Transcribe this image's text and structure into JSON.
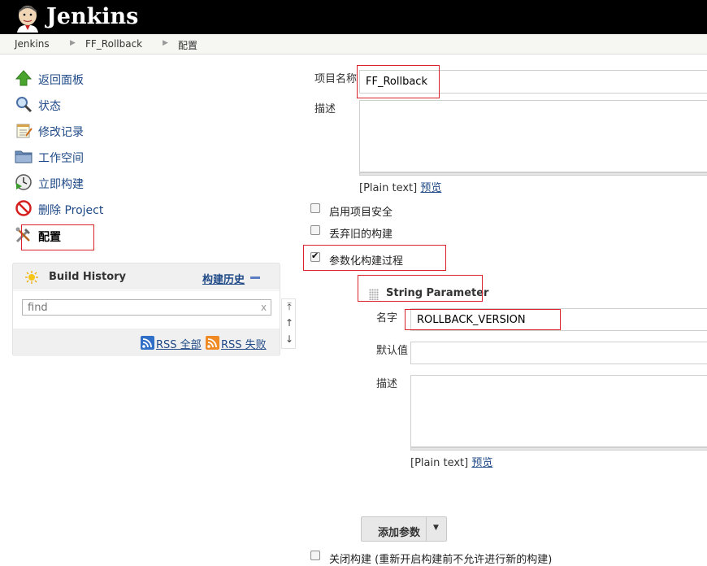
{
  "header": {
    "brand": "Jenkins"
  },
  "breadcrumb": [
    "Jenkins",
    "FF_Rollback",
    "配置"
  ],
  "side_tasks": [
    {
      "label": "返回面板",
      "icon": "up-arrow-icon"
    },
    {
      "label": "状态",
      "icon": "magnifier-icon"
    },
    {
      "label": "修改记录",
      "icon": "notepad-icon"
    },
    {
      "label": "工作空间",
      "icon": "folder-icon"
    },
    {
      "label": "立即构建",
      "icon": "clock-play-icon"
    },
    {
      "label": "删除 Project",
      "icon": "no-entry-icon"
    },
    {
      "label": "配置",
      "icon": "tools-icon"
    }
  ],
  "build_history": {
    "title": "Build History",
    "trend_link": "构建历史",
    "search_placeholder": "find",
    "clear": "x",
    "rss_all": "RSS 全部",
    "rss_failures": "RSS 失败"
  },
  "form": {
    "project_name_label": "项目名称",
    "project_name_value": "FF_Rollback",
    "description_label": "描述",
    "plain_text": "[Plain text]",
    "preview": "预览",
    "options": [
      {
        "label": "启用项目安全",
        "checked": false
      },
      {
        "label": "丢弃旧的构建",
        "checked": false
      },
      {
        "label": "参数化构建过程",
        "checked": true
      }
    ],
    "string_param": {
      "title": "String Parameter",
      "name_label": "名字",
      "name_value": "ROLLBACK_VERSION",
      "default_label": "默认值",
      "default_value": "",
      "desc_label": "描述"
    },
    "add_param_button": "添加参数",
    "disable_build_label": "关闭构建 (重新开启构建前不允许进行新的构建)"
  },
  "colors": {
    "header_bg": "#000000",
    "link": "#204a87",
    "highlight_box": "#d9232b"
  }
}
